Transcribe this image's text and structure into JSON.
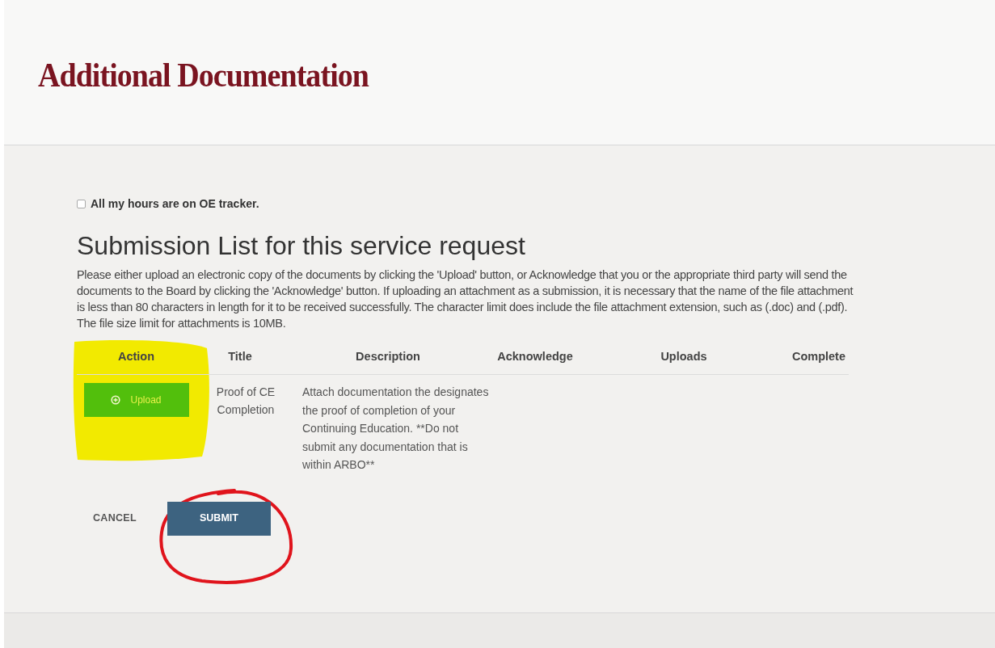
{
  "page_title": "Additional Documentation",
  "checkbox": {
    "label": "All my hours are on OE tracker.",
    "checked": false
  },
  "heading": "Submission List for this service request",
  "instructions": "Please either upload an electronic copy of the documents by clicking the 'Upload' button, or Acknowledge that you or the appropriate third party will send the documents to the Board by clicking the 'Acknowledge' button. If uploading an attachment as a submission, it is necessary that the name of the file attachment is less than 80 characters in length for it to be received successfully. The character limit does include the file attachment extension, such as (.doc) and (.pdf). The file size limit for attachments is 10MB.",
  "table": {
    "columns": [
      "Action",
      "Title",
      "Description",
      "Acknowledge",
      "Uploads",
      "Complete"
    ],
    "rows": [
      {
        "action": "Upload",
        "title": "Proof of CE Completion",
        "description": "Attach documentation the designates the proof of completion of your Continuing Education. **Do not submit any documentation that is within ARBO**"
      }
    ]
  },
  "buttons": [
    {
      "label": "CANCEL",
      "kind": "link"
    },
    {
      "label": "SUBMIT",
      "kind": "primary"
    }
  ],
  "annotations": [
    {
      "kind": "highlight",
      "color": "#f2ea00"
    },
    {
      "kind": "circle",
      "color": "#e0141c"
    }
  ]
}
